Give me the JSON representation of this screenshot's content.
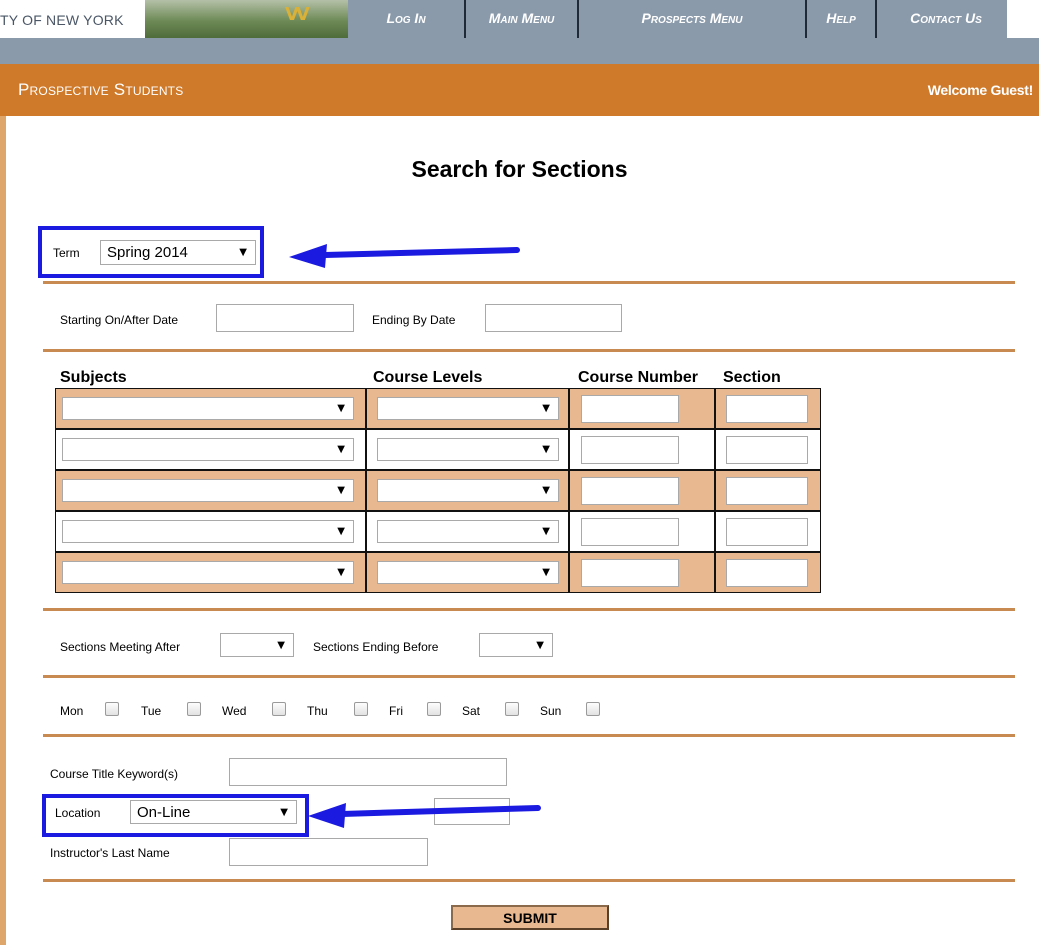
{
  "banner": {
    "college_name": "TY OF NEW YORK",
    "logo_text": "VV"
  },
  "nav": {
    "items": [
      {
        "label": "Log In"
      },
      {
        "label": "Main Menu"
      },
      {
        "label": "Prospects Menu"
      },
      {
        "label": "Help"
      },
      {
        "label": "Contact Us"
      }
    ]
  },
  "header": {
    "title": "Prospective Students",
    "welcome": "Welcome Guest!"
  },
  "page": {
    "title": "Search for Sections"
  },
  "form": {
    "term_label": "Term",
    "term_value": "Spring 2014",
    "starting_date_label": "Starting On/After Date",
    "starting_date_value": "",
    "ending_date_label": "Ending By Date",
    "ending_date_value": "",
    "grid_headers": {
      "subjects": "Subjects",
      "course_levels": "Course Levels",
      "course_number": "Course Number",
      "section": "Section"
    },
    "grid_rows": [
      {
        "subject": "",
        "level": "",
        "number": "",
        "section": ""
      },
      {
        "subject": "",
        "level": "",
        "number": "",
        "section": ""
      },
      {
        "subject": "",
        "level": "",
        "number": "",
        "section": ""
      },
      {
        "subject": "",
        "level": "",
        "number": "",
        "section": ""
      },
      {
        "subject": "",
        "level": "",
        "number": "",
        "section": ""
      }
    ],
    "meeting_after_label": "Sections Meeting After",
    "meeting_after_value": "",
    "ending_before_label": "Sections Ending Before",
    "ending_before_value": "",
    "days": [
      {
        "label": "Mon",
        "checked": false
      },
      {
        "label": "Tue",
        "checked": false
      },
      {
        "label": "Wed",
        "checked": false
      },
      {
        "label": "Thu",
        "checked": false
      },
      {
        "label": "Fri",
        "checked": false
      },
      {
        "label": "Sat",
        "checked": false
      },
      {
        "label": "Sun",
        "checked": false
      }
    ],
    "keyword_label": "Course Title Keyword(s)",
    "keyword_value": "",
    "location_label": "Location",
    "location_value": "On-Line",
    "instructor_label": "Instructor's Last Name",
    "instructor_value": "",
    "submit_label": "SUBMIT"
  },
  "colors": {
    "header_orange": "#cf7a2a",
    "row_tan": "#e8b890",
    "highlight_blue": "#1a1ae0",
    "divider": "#c98a52",
    "nav_gray": "#8a9aab"
  },
  "icons": {
    "dropdown": "chevron-down-icon",
    "annotation": "arrow-left-icon"
  }
}
